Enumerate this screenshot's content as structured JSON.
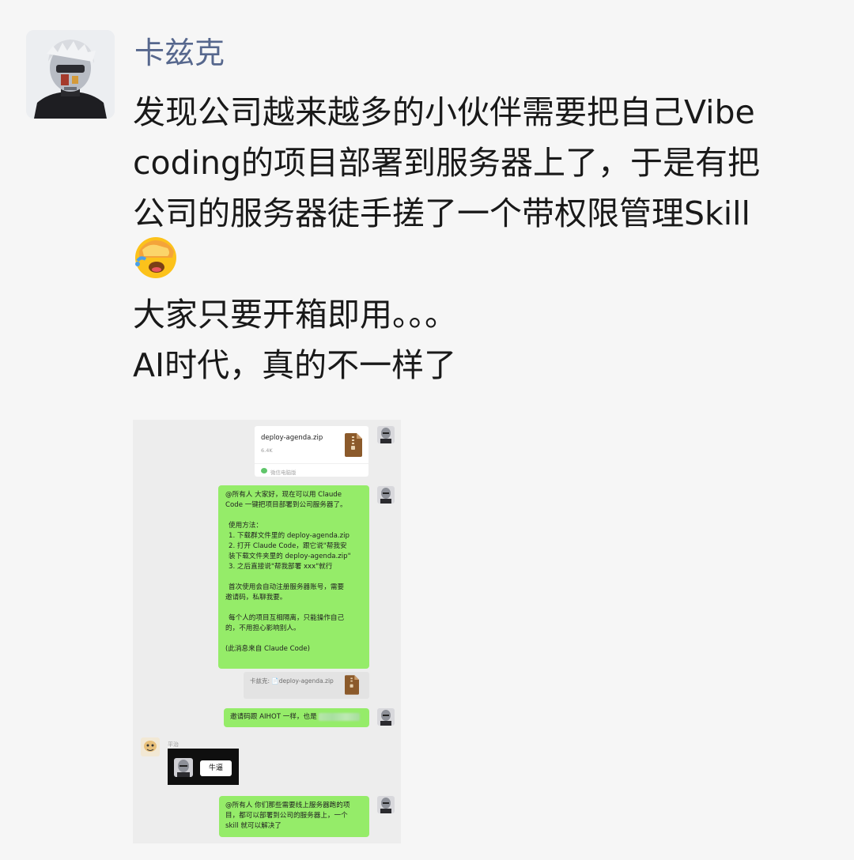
{
  "post": {
    "author": "卡兹克",
    "text_lines": [
      "发现公司越来越多的小伙伴需要把自己Vibe",
      "coding的项目部署到服务器上了，于是有把",
      "公司的服务器徒手搓了一个带权限管理Skill",
      "大家只要开箱即用。。。",
      "AI时代，真的不一样了"
    ],
    "emoji": "facepalm-emoji"
  },
  "chat": {
    "file": {
      "name": "deploy-agenda.zip",
      "size": "6.4K",
      "source": "微信电脑版"
    },
    "message1": {
      "lines": [
        "@所有人  大家好，现在可以用 Claude",
        "Code 一键把项目部署到公司服务器了。",
        "",
        "使用方法：",
        "1. 下载群文件里的 deploy-agenda.zip",
        "2. 打开 Claude Code，跟它说\"帮我安",
        "装下载文件夹里的 deploy-agenda.zip\"",
        "3. 之后直接说\"帮我部署 xxx\"就行",
        "",
        "首次使用会自动注册服务器账号，需要",
        "邀请码，私聊我要。",
        "",
        "每个人的项目互相隔离，只能操作自己",
        "的，不用担心影响别人。",
        "",
        "(此消息来自 Claude Code)"
      ]
    },
    "quote": {
      "text": "卡兹克: 📄deploy-agenda.zip"
    },
    "message2": {
      "text": "邀请码跟 AIHOT 一样，也是"
    },
    "other": {
      "nickname": "平治",
      "reply": "牛逼"
    },
    "message3": {
      "lines": [
        "@所有人 你们那些需要线上服务器跑的项",
        "目，都可以部署到公司的服务器上，一个",
        "skill 就可以解决了"
      ]
    }
  }
}
